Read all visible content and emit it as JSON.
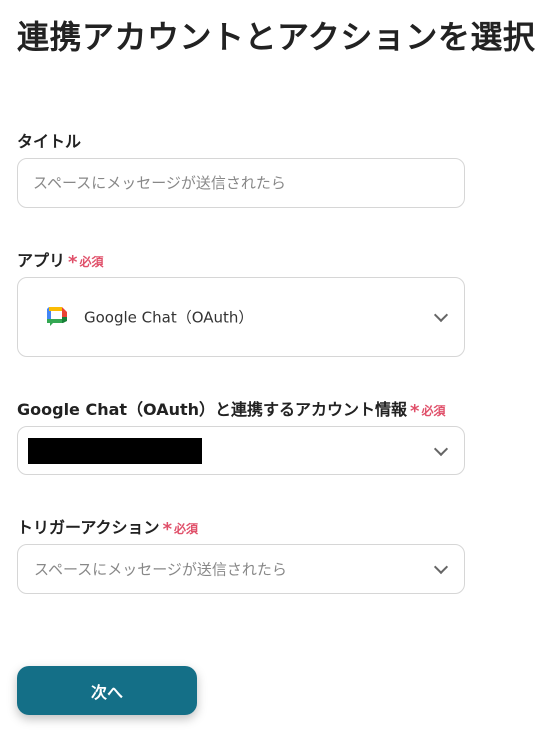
{
  "page": {
    "title": "連携アカウントとアクションを選択"
  },
  "fields": {
    "title_field": {
      "label": "タイトル",
      "placeholder": "スペースにメッセージが送信されたら"
    },
    "app_field": {
      "label": "アプリ",
      "required_mark": "*",
      "required_text": "必須",
      "value": "Google Chat（OAuth）",
      "icon": "google-chat-icon"
    },
    "account_field": {
      "label": "Google Chat（OAuth）と連携するアカウント情報",
      "required_mark": "*",
      "required_text": "必須"
    },
    "trigger_field": {
      "label": "トリガーアクション",
      "required_mark": "*",
      "required_text": "必須",
      "value": "スペースにメッセージが送信されたら"
    }
  },
  "actions": {
    "next_label": "次へ"
  },
  "colors": {
    "accent": "#146f87",
    "required": "#e0506a",
    "border": "#d6d6d6"
  }
}
